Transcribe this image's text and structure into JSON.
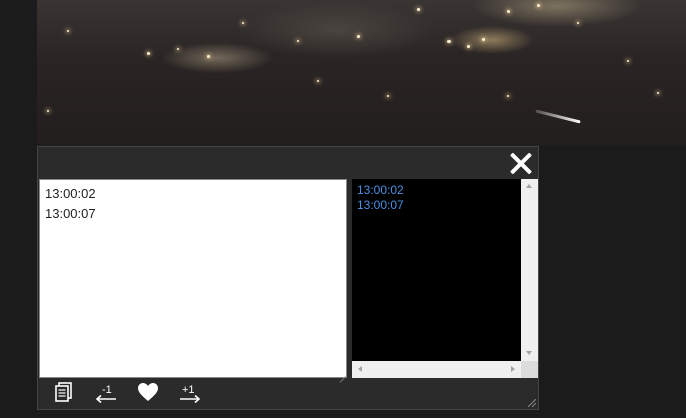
{
  "notes": {
    "value": "13:00:02\n13:00:07"
  },
  "timestamps": {
    "items": [
      "13:00:02",
      "13:00:07"
    ]
  },
  "toolbar": {
    "minus_label": "-1",
    "plus_label": "+1"
  },
  "colors": {
    "timestamp_text": "#4a90e2",
    "panel_bg": "#2b2b2b",
    "page_bg": "#1b1b1b"
  },
  "icons": {
    "close": "close-icon",
    "copy": "copy-icon",
    "minus_one": "step-back-icon",
    "favorite": "heart-icon",
    "plus_one": "step-forward-icon"
  }
}
